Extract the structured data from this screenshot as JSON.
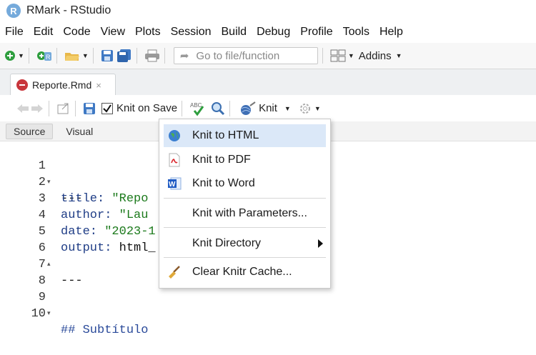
{
  "window": {
    "app_initial": "R",
    "title": "RMark - RStudio"
  },
  "menubar": {
    "items": [
      "File",
      "Edit",
      "Code",
      "View",
      "Plots",
      "Session",
      "Build",
      "Debug",
      "Profile",
      "Tools",
      "Help"
    ]
  },
  "toolbar": {
    "goto_placeholder": "Go to file/function",
    "addins_label": "Addins"
  },
  "tabs": [
    {
      "label": "Reporte.Rmd",
      "close": "×"
    }
  ],
  "editor_toolbar": {
    "knit_on_save_label": "Knit on Save",
    "knit_label": "Knit",
    "spell_label": "ABC"
  },
  "modes": [
    {
      "label": "Source",
      "active": true
    },
    {
      "label": "Visual",
      "active": false
    }
  ],
  "editor": {
    "lines": [
      {
        "num": "1",
        "fold": "▾",
        "text": "---"
      },
      {
        "num": "2",
        "key": "title: ",
        "val": "\"Repo"
      },
      {
        "num": "3",
        "key": "author: ",
        "val": "\"Lau"
      },
      {
        "num": "4",
        "key": "date: ",
        "val": "\"2023-1"
      },
      {
        "num": "5",
        "key": "output: ",
        "plain": "html_"
      },
      {
        "num": "6",
        "fold": "▴",
        "text": "---"
      },
      {
        "num": "7",
        "text": ""
      },
      {
        "num": "8",
        "text": ""
      },
      {
        "num": "9",
        "fold": "▾",
        "comment": "## Subtítulo"
      },
      {
        "num": "10",
        "text": ""
      }
    ]
  },
  "knit_menu": {
    "items": [
      {
        "label": "Knit to HTML",
        "icon": "globe-icon",
        "selected": true
      },
      {
        "label": "Knit to PDF",
        "icon": "pdf-icon"
      },
      {
        "label": "Knit to Word",
        "icon": "word-icon"
      },
      {
        "label": "Knit with Parameters..."
      },
      {
        "label": "Knit Directory",
        "submenu": true
      },
      {
        "label": "Clear Knitr Cache...",
        "icon": "broom-icon"
      }
    ]
  },
  "colors": {
    "selection": "#dbe8f8",
    "string": "#1c7a1c",
    "keyword": "#1f3d86"
  }
}
